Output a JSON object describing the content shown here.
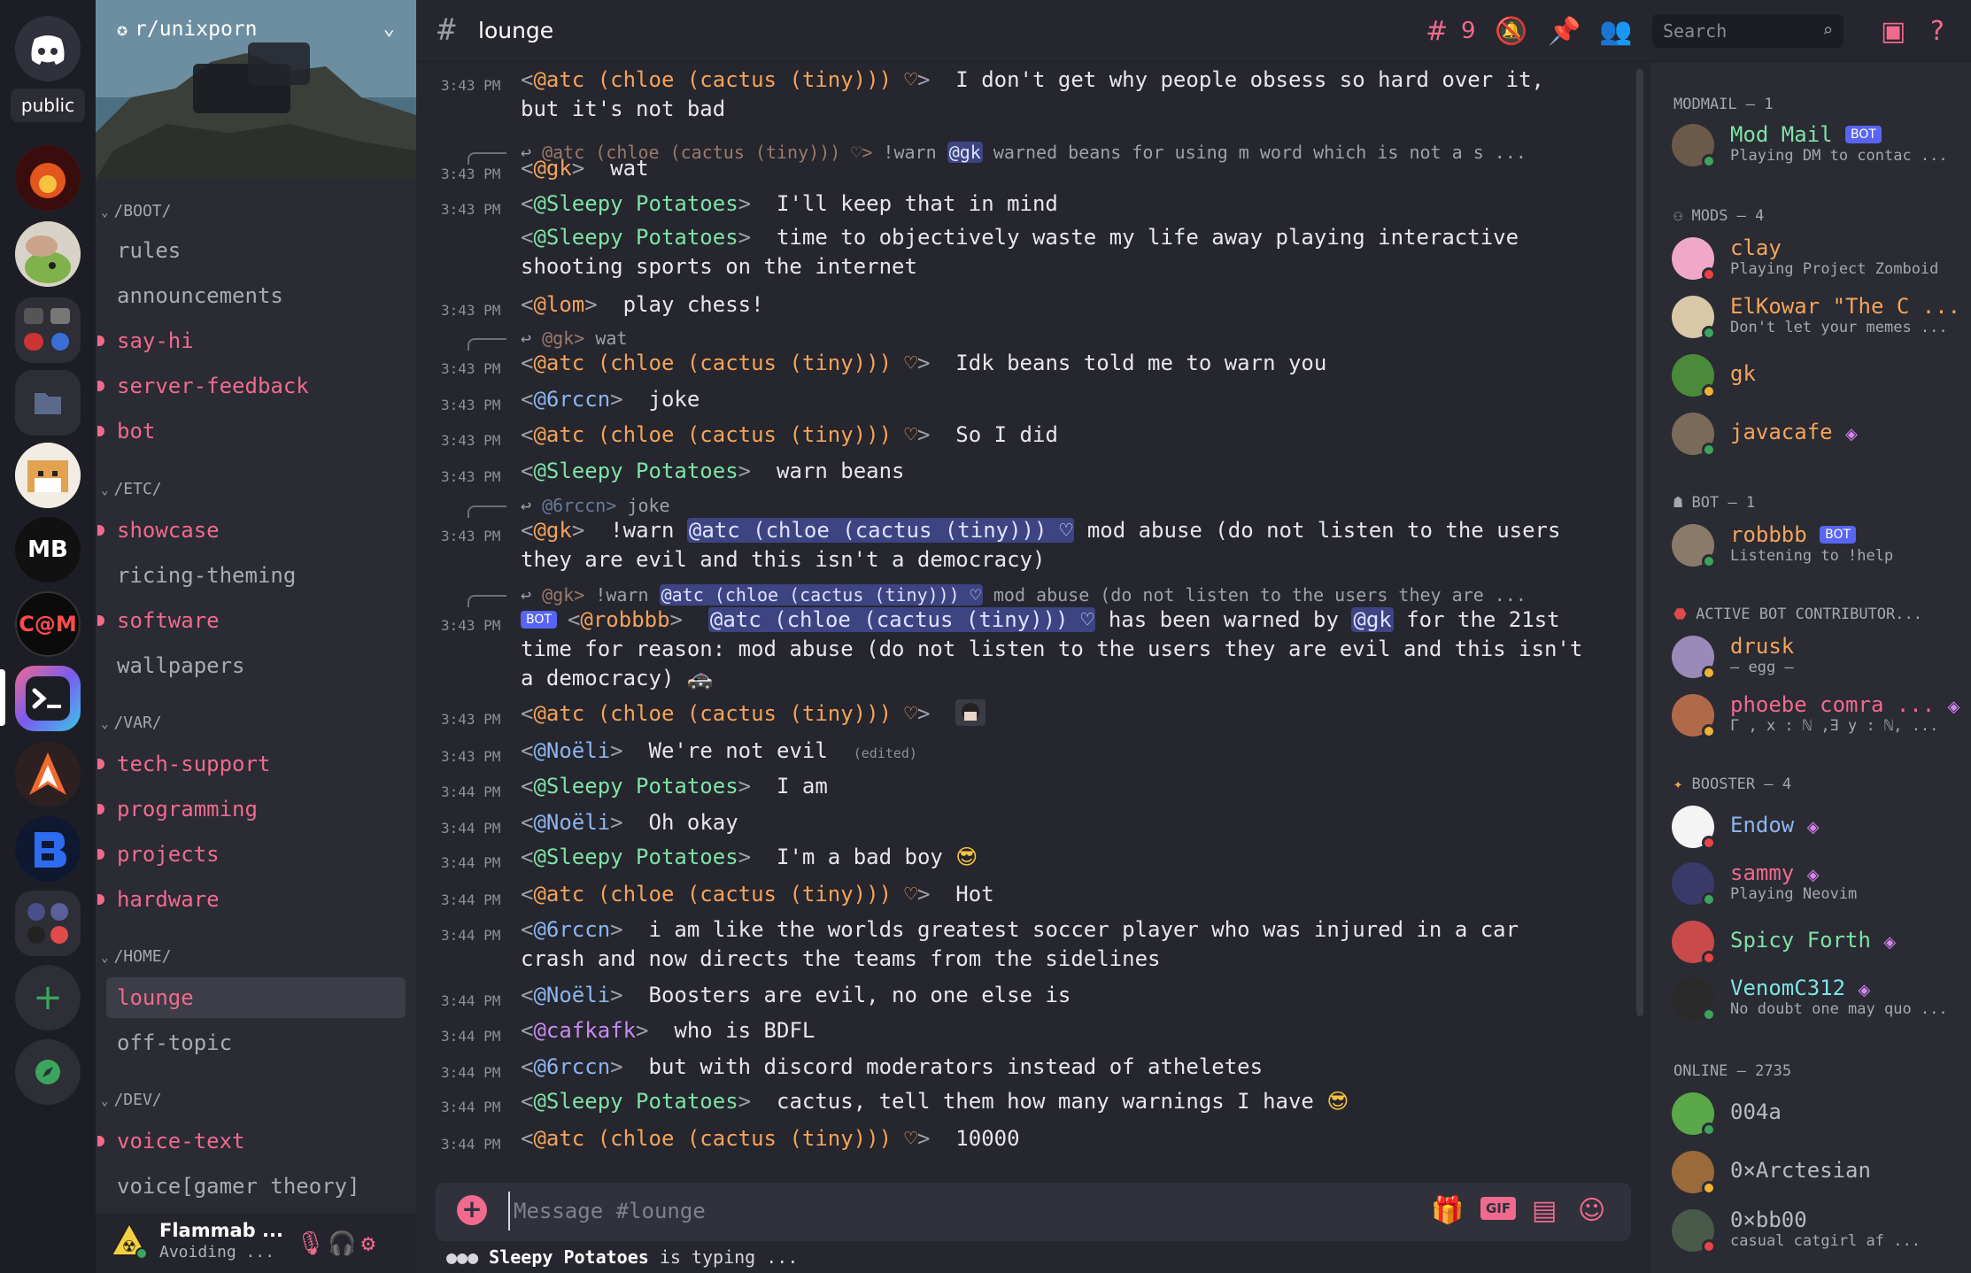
{
  "rail": {
    "public_label": "public",
    "mb_label": "MB",
    "cam_label": "C@M"
  },
  "server": {
    "name": "r/unixporn"
  },
  "categories": {
    "boot": "/BOOT/",
    "etc": "/ETC/",
    "var": "/VAR/",
    "home": "/HOME/",
    "dev": "/DEV/"
  },
  "channels": {
    "rules": "rules",
    "announcements": "announcements",
    "say_hi": "say-hi",
    "server_feedback": "server-feedback",
    "bot": "bot",
    "showcase": "showcase",
    "ricing_theming": "ricing-theming",
    "software": "software",
    "wallpapers": "wallpapers",
    "tech_support": "tech-support",
    "programming": "programming",
    "projects": "projects",
    "hardware": "hardware",
    "lounge": "lounge",
    "off_topic": "off-topic",
    "voice_text": "voice-text",
    "voice_gamer": "voice[gamer theory]"
  },
  "user_panel": {
    "name": "Flammab ...",
    "status": "Avoiding ..."
  },
  "header": {
    "channel": "lounge",
    "thread_count": "9",
    "search_placeholder": "Search"
  },
  "messages": {
    "m1": {
      "time": "3:43 PM",
      "author": "@atc (chloe (cactus (tiny))) ♡",
      "text": "I don't get why people obsess so hard over it,",
      "text2": "but it's not bad"
    },
    "r2": {
      "author": "@atc (chloe (cactus (tiny))) ♡>",
      "pre": "!warn",
      "mention": "@gk",
      "text": "warned beans for using m word which is not a s ..."
    },
    "m2": {
      "time": "3:43 PM",
      "author": "@gk",
      "text": "wat"
    },
    "m3": {
      "time": "3:43 PM",
      "author": "@Sleepy Potatoes",
      "text": "I'll keep that in mind"
    },
    "m4": {
      "author": "@Sleepy Potatoes",
      "text": "time to objectively waste my life away playing interactive",
      "text2": "shooting sports on the internet"
    },
    "m5": {
      "time": "3:43 PM",
      "author": "@lom",
      "text": "play chess!"
    },
    "r6": {
      "author": "@gk>",
      "text": "wat"
    },
    "m6": {
      "time": "3:43 PM",
      "author": "@atc (chloe (cactus (tiny))) ♡",
      "text": "Idk beans told me to warn you"
    },
    "m7": {
      "time": "3:43 PM",
      "author": "@6rccn",
      "text": "joke"
    },
    "m8": {
      "time": "3:43 PM",
      "author": "@atc (chloe (cactus (tiny))) ♡",
      "text": "So I did"
    },
    "m9": {
      "time": "3:43 PM",
      "author": "@Sleepy Potatoes",
      "text": "warn beans"
    },
    "r10": {
      "author": "@6rccn>",
      "text": "joke"
    },
    "m10": {
      "time": "3:43 PM",
      "author": "@gk",
      "pre": "!warn",
      "mention": "@atc (chloe (cactus (tiny))) ♡",
      "text": "mod abuse (do not listen to the users",
      "text2": "they are evil and this isn't a democracy)"
    },
    "r11": {
      "author": "@gk>",
      "pre": "!warn",
      "mention": "@atc (chloe (cactus (tiny))) ♡",
      "text": "mod abuse (do not listen to the users they are ..."
    },
    "m11": {
      "time": "3:43 PM",
      "badge": "BOT",
      "author": "@robbbb",
      "mention": "@atc (chloe (cactus (tiny))) ♡",
      "mid": "has been warned by",
      "mention2": "@gk",
      "text": "for the 21st",
      "text2": "time for reason: mod abuse (do not listen to the users they are evil and this isn't",
      "text3": "a democracy)"
    },
    "m12": {
      "time": "3:43 PM",
      "author": "@atc (chloe (cactus (tiny))) ♡"
    },
    "m13": {
      "time": "3:43 PM",
      "author": "@Noëli",
      "text": "We're not evil",
      "edited": "(edited)"
    },
    "m14": {
      "time": "3:44 PM",
      "author": "@Sleepy Potatoes",
      "text": "I am"
    },
    "m15": {
      "time": "3:44 PM",
      "author": "@Noëli",
      "text": "Oh okay"
    },
    "m16": {
      "time": "3:44 PM",
      "author": "@Sleepy Potatoes",
      "text": "I'm a bad boy"
    },
    "m17": {
      "time": "3:44 PM",
      "author": "@atc (chloe (cactus (tiny))) ♡",
      "text": "Hot"
    },
    "m18": {
      "time": "3:44 PM",
      "author": "@6rccn",
      "text": "i am like the worlds greatest soccer player who was injured in a car",
      "text2": "crash and now directs the teams from the sidelines"
    },
    "m19": {
      "time": "3:44 PM",
      "author": "@Noëli",
      "text": "Boosters are evil, no one else is"
    },
    "m20": {
      "time": "3:44 PM",
      "author": "@cafkafk",
      "text": "who is BDFL"
    },
    "m21": {
      "time": "3:44 PM",
      "author": "@6rccn",
      "text": "but with discord moderators instead of atheletes"
    },
    "m22": {
      "time": "3:44 PM",
      "author": "@Sleepy Potatoes",
      "text": "cactus, tell them how many warnings I have"
    },
    "m23": {
      "time": "3:44 PM",
      "author": "@atc (chloe (cactus (tiny))) ♡",
      "text": "10000"
    }
  },
  "composer": {
    "placeholder": "Message #lounge",
    "gif": "GIF"
  },
  "typing": {
    "name": "Sleepy Potatoes",
    "text": "is typing ..."
  },
  "members": {
    "modmail_group": "MODMAIL — 1",
    "mods_group": "MODS — 4",
    "bot_group": "BOT — 1",
    "abc_group": "ACTIVE BOT CONTRIBUTOR...",
    "booster_group": "BOOSTER — 4",
    "online_group": "ONLINE — 2735",
    "bot_badge": "BOT",
    "modmail": {
      "name": "Mod Mail",
      "sub": "Playing DM to contac ..."
    },
    "clay": {
      "name": "clay",
      "sub": "Playing Project Zomboid"
    },
    "elkowar": {
      "name": "ElKowar \"The C ...",
      "sub": "Don't let your memes ..."
    },
    "gk": {
      "name": "gk"
    },
    "javacafe": {
      "name": "javacafe"
    },
    "robbbb": {
      "name": "robbbb",
      "sub": "Listening to !help"
    },
    "drusk": {
      "name": "drusk",
      "sub": "– egg –"
    },
    "phoebe": {
      "name": "phoebe comra ...",
      "sub": "Γ , x : ℕ ,∃ y : ℕ, ..."
    },
    "endow": {
      "name": "Endow"
    },
    "sammy": {
      "name": "sammy",
      "sub": "Playing Neovim"
    },
    "spicy": {
      "name": "Spicy Forth"
    },
    "venom": {
      "name": "VenomC312",
      "sub": "No doubt one may quo ..."
    },
    "u004a": {
      "name": "004a"
    },
    "arctesian": {
      "name": "0×Arctesian"
    },
    "bb00": {
      "name": "0×bb00",
      "sub": "casual catgirl af ..."
    }
  },
  "colors": {
    "accent": "#f06a8e",
    "background": "#25262e",
    "sidebar": "#2a2b33",
    "mention": "#3d4482",
    "online": "#3ba55d",
    "dnd": "#ed4245",
    "idle": "#f0b232"
  },
  "icons": [
    "discord-icon",
    "threads-icon",
    "mute-icon",
    "pin-icon",
    "members-icon",
    "search-icon",
    "inbox-icon",
    "help-icon",
    "mic-icon",
    "headphones-icon",
    "settings-icon",
    "gift-icon",
    "sticker-icon",
    "emoji-icon",
    "add-server-icon",
    "explore-icon"
  ]
}
